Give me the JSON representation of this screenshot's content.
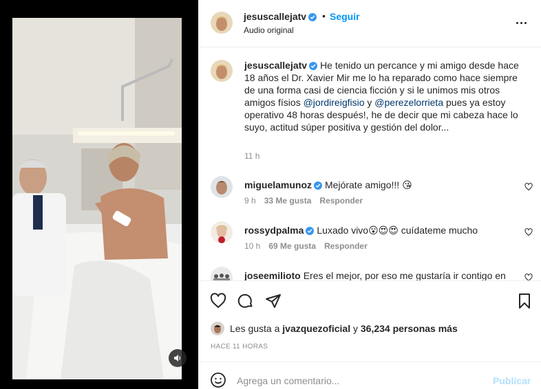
{
  "header": {
    "username": "jesuscallejatv",
    "separator": "•",
    "follow_label": "Seguir",
    "audio_label": "Audio original"
  },
  "caption": {
    "username": "jesuscallejatv",
    "text_part1": "He tenido un percance y mi amigo desde hace 18 años el Dr. Xavier Mir me lo ha reparado como hace siempre de una forma casi de ciencia ficción y si le unimos mis otros amigos físios ",
    "mention1": "@jordireigfisio",
    "text_part2": " y ",
    "mention2": "@perezelorrieta",
    "text_part3": " pues ya estoy operativo 48 horas después!, he de decir que mi cabeza hace lo suyo, actitud súper positiva y gestión del dolor...",
    "time": "11 h"
  },
  "comments": [
    {
      "username": "miguelamunoz",
      "text": "Mejórate amigo!!! 😘",
      "time": "9 h",
      "likes": "33 Me gusta",
      "reply": "Responder"
    },
    {
      "username": "rossydpalma",
      "text": "Luxado vivo😮😍😍 cuídateme mucho",
      "time": "10 h",
      "likes": "69 Me gusta",
      "reply": "Responder"
    },
    {
      "username": "joseemilioto",
      "text": "Eres el mejor, por eso me gustaría ir contigo en"
    }
  ],
  "likes": {
    "prefix": "Les gusta a",
    "user": "jvazquezoficial",
    "middle": "y",
    "count": "36,234 personas más"
  },
  "post_time": "HACE 11 HORAS",
  "add_comment": {
    "placeholder": "Agrega un comentario...",
    "publish_label": "Publicar"
  },
  "colors": {
    "link_blue": "#0095f6",
    "mention_blue": "#00376b",
    "verified": "#3897f0",
    "publish_disabled": "#b2dffc",
    "meta_gray": "#8e8e8e"
  },
  "icons": [
    "more-icon",
    "heart-icon",
    "comment-icon",
    "share-icon",
    "bookmark-icon",
    "emoji-icon",
    "speaker-icon",
    "verified-icon"
  ]
}
